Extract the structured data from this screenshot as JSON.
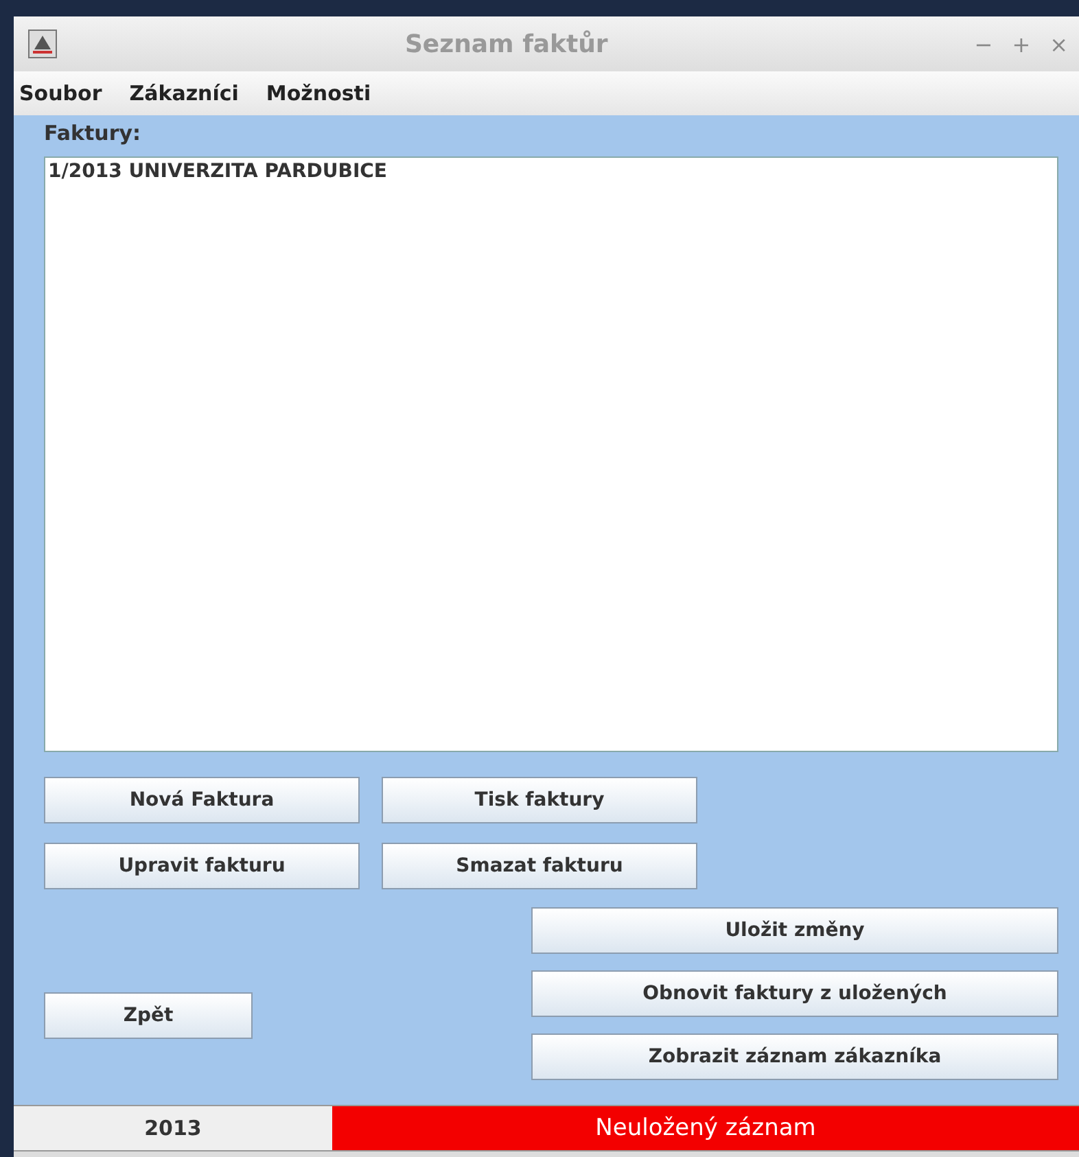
{
  "window": {
    "title": "Seznam faktůr",
    "controls": [
      "−",
      "+",
      "×"
    ]
  },
  "menu": [
    "Soubor",
    "Zákazníci",
    "Možnosti"
  ],
  "list_label": "Faktury:",
  "invoices": [
    {
      "text": "1/2013 UNIVERZITA PARDUBICE",
      "selected": false
    }
  ],
  "buttons_left": [
    [
      "Nová Faktura",
      "Tisk faktury"
    ],
    [
      "Upravit fakturu",
      "Smazat fakturu"
    ]
  ],
  "back_button": "Zpět",
  "buttons_right": [
    "Uložit změny",
    "Obnovit faktury z uložených",
    "Zobrazit záznam zákazníka"
  ],
  "status_bar": {
    "year": "2013",
    "message": "Neuložený záznam",
    "unsaved": true
  }
}
